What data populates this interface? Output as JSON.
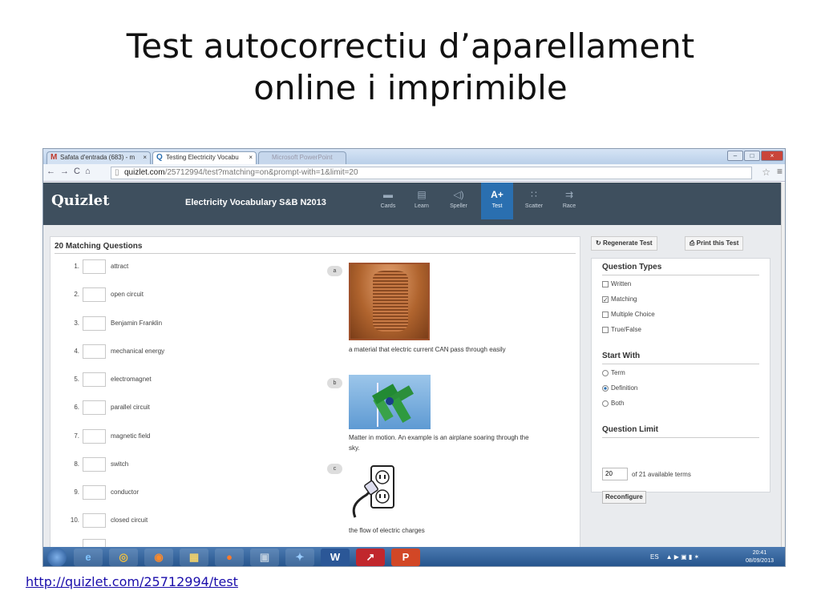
{
  "slide": {
    "title_line1": "Test autocorrectiu d’aparellament",
    "title_line2": "online i imprimible",
    "link": "http://quizlet.com/25712994/test"
  },
  "browser": {
    "tabs": [
      {
        "icon": "M",
        "label": "Safata d'entrada (683) - m",
        "close": "×"
      },
      {
        "icon": "Q",
        "label": "Testing Electricity Vocabu",
        "close": "×"
      },
      {
        "icon": "",
        "label": "Microsoft PowerPoint",
        "close": ""
      }
    ],
    "url_domain": "quizlet.com",
    "url_path": "/25712994/test?matching=on&prompt-with=1&limit=20",
    "window_controls": [
      "–",
      "□",
      "×"
    ]
  },
  "quizlet": {
    "logo": "Quizlet",
    "set_title": "Electricity Vocabulary S&B N2013",
    "modes": [
      {
        "icon": "▬",
        "label": "Cards"
      },
      {
        "icon": "▤",
        "label": "Learn"
      },
      {
        "icon": "◁)",
        "label": "Speller"
      },
      {
        "icon": "A+",
        "label": "Test"
      },
      {
        "icon": "∷",
        "label": "Scatter"
      },
      {
        "icon": "⇉",
        "label": "Race"
      }
    ],
    "active_mode": "Test"
  },
  "test": {
    "heading": "20 Matching Questions",
    "questions": [
      {
        "num": "1.",
        "term": "attract"
      },
      {
        "num": "2.",
        "term": "open circuit"
      },
      {
        "num": "3.",
        "term": "Benjamin Franklin"
      },
      {
        "num": "4.",
        "term": "mechanical energy"
      },
      {
        "num": "5.",
        "term": "electromagnet"
      },
      {
        "num": "6.",
        "term": "parallel circuit"
      },
      {
        "num": "7.",
        "term": "magnetic field"
      },
      {
        "num": "8.",
        "term": "switch"
      },
      {
        "num": "9.",
        "term": "conductor"
      },
      {
        "num": "10.",
        "term": "closed circuit"
      }
    ],
    "answers": [
      {
        "letter": "a",
        "text": "a material that electric current CAN pass through easily",
        "image": "copper-wire-coil"
      },
      {
        "letter": "b",
        "text": "Matter in motion. An example is an airplane soaring through the sky.",
        "image": "pinwheel-wind-turbine"
      },
      {
        "letter": "c",
        "text": "the flow of electric charges",
        "image": "plug-outlet"
      }
    ]
  },
  "sidebar": {
    "regenerate": "Regenerate Test",
    "print": "Print this Test",
    "qtypes_heading": "Question Types",
    "qtypes": [
      {
        "label": "Written",
        "checked": false
      },
      {
        "label": "Matching",
        "checked": true
      },
      {
        "label": "Multiple Choice",
        "checked": false
      },
      {
        "label": "True/False",
        "checked": false
      }
    ],
    "start_heading": "Start With",
    "start_options": [
      {
        "label": "Term",
        "selected": false
      },
      {
        "label": "Definition",
        "selected": true
      },
      {
        "label": "Both",
        "selected": false
      }
    ],
    "limit_heading": "Question Limit",
    "limit_value": "20",
    "limit_text": "of 21 available terms",
    "reconfigure": "Reconfigure"
  },
  "taskbar": {
    "apps": [
      "e",
      "◎",
      "◉",
      "▦",
      "●",
      "▣",
      "✦",
      "W",
      "↗",
      "P"
    ],
    "language": "ES",
    "tray_icons": "▲ ▶ ▣ ▮ ✶",
    "time": "20:41",
    "date": "08/09/2013"
  },
  "colors": {
    "quizlet_header": "#3e4f5e",
    "active_mode": "#2a6fb0",
    "taskbar": "#23528a",
    "link": "#1a0dab"
  }
}
